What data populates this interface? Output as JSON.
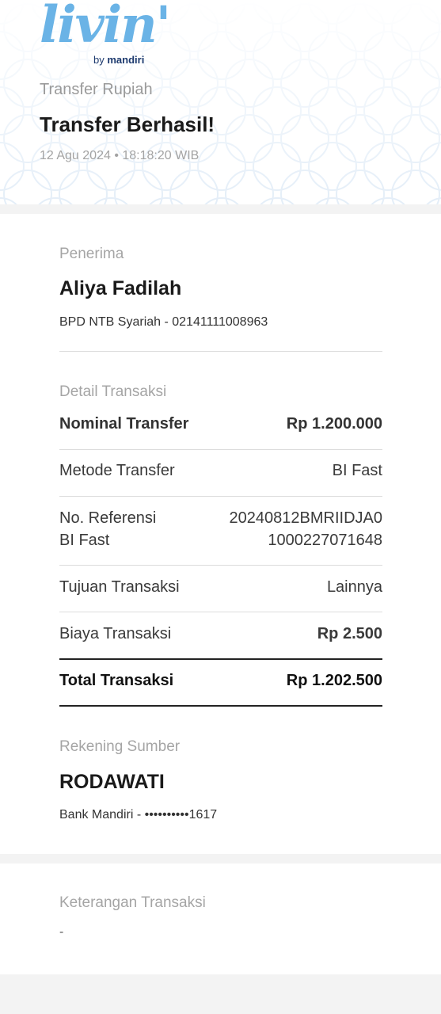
{
  "brand": {
    "logo_word": "livin'",
    "logo_by": "by",
    "logo_bank": "mandiri"
  },
  "header": {
    "subtitle": "Transfer Rupiah",
    "title": "Transfer Berhasil!",
    "datetime": "12 Agu 2024 • 18:18:20 WIB"
  },
  "recipient": {
    "label": "Penerima",
    "name": "Aliya Fadilah",
    "bank_account": "BPD NTB Syariah - 02141111008963"
  },
  "details": {
    "label": "Detail Transaksi",
    "rows": [
      {
        "label": "Nominal Transfer",
        "value": "Rp 1.200.000"
      },
      {
        "label": "Metode Transfer",
        "value": "BI Fast"
      },
      {
        "label_line1": "No. Referensi",
        "label_line2": "BI Fast",
        "value_line1": "20240812BMRIIDJA0",
        "value_line2": "1000227071648"
      },
      {
        "label": "Tujuan Transaksi",
        "value": "Lainnya"
      },
      {
        "label": "Biaya Transaksi",
        "value": "Rp 2.500"
      },
      {
        "label": "Total Transaksi",
        "value": "Rp 1.202.500"
      }
    ]
  },
  "source": {
    "label": "Rekening Sumber",
    "name": "RODAWATI",
    "account": "Bank Mandiri - ••••••••••1617"
  },
  "note": {
    "label": "Keterangan Transaksi",
    "value": "-"
  }
}
